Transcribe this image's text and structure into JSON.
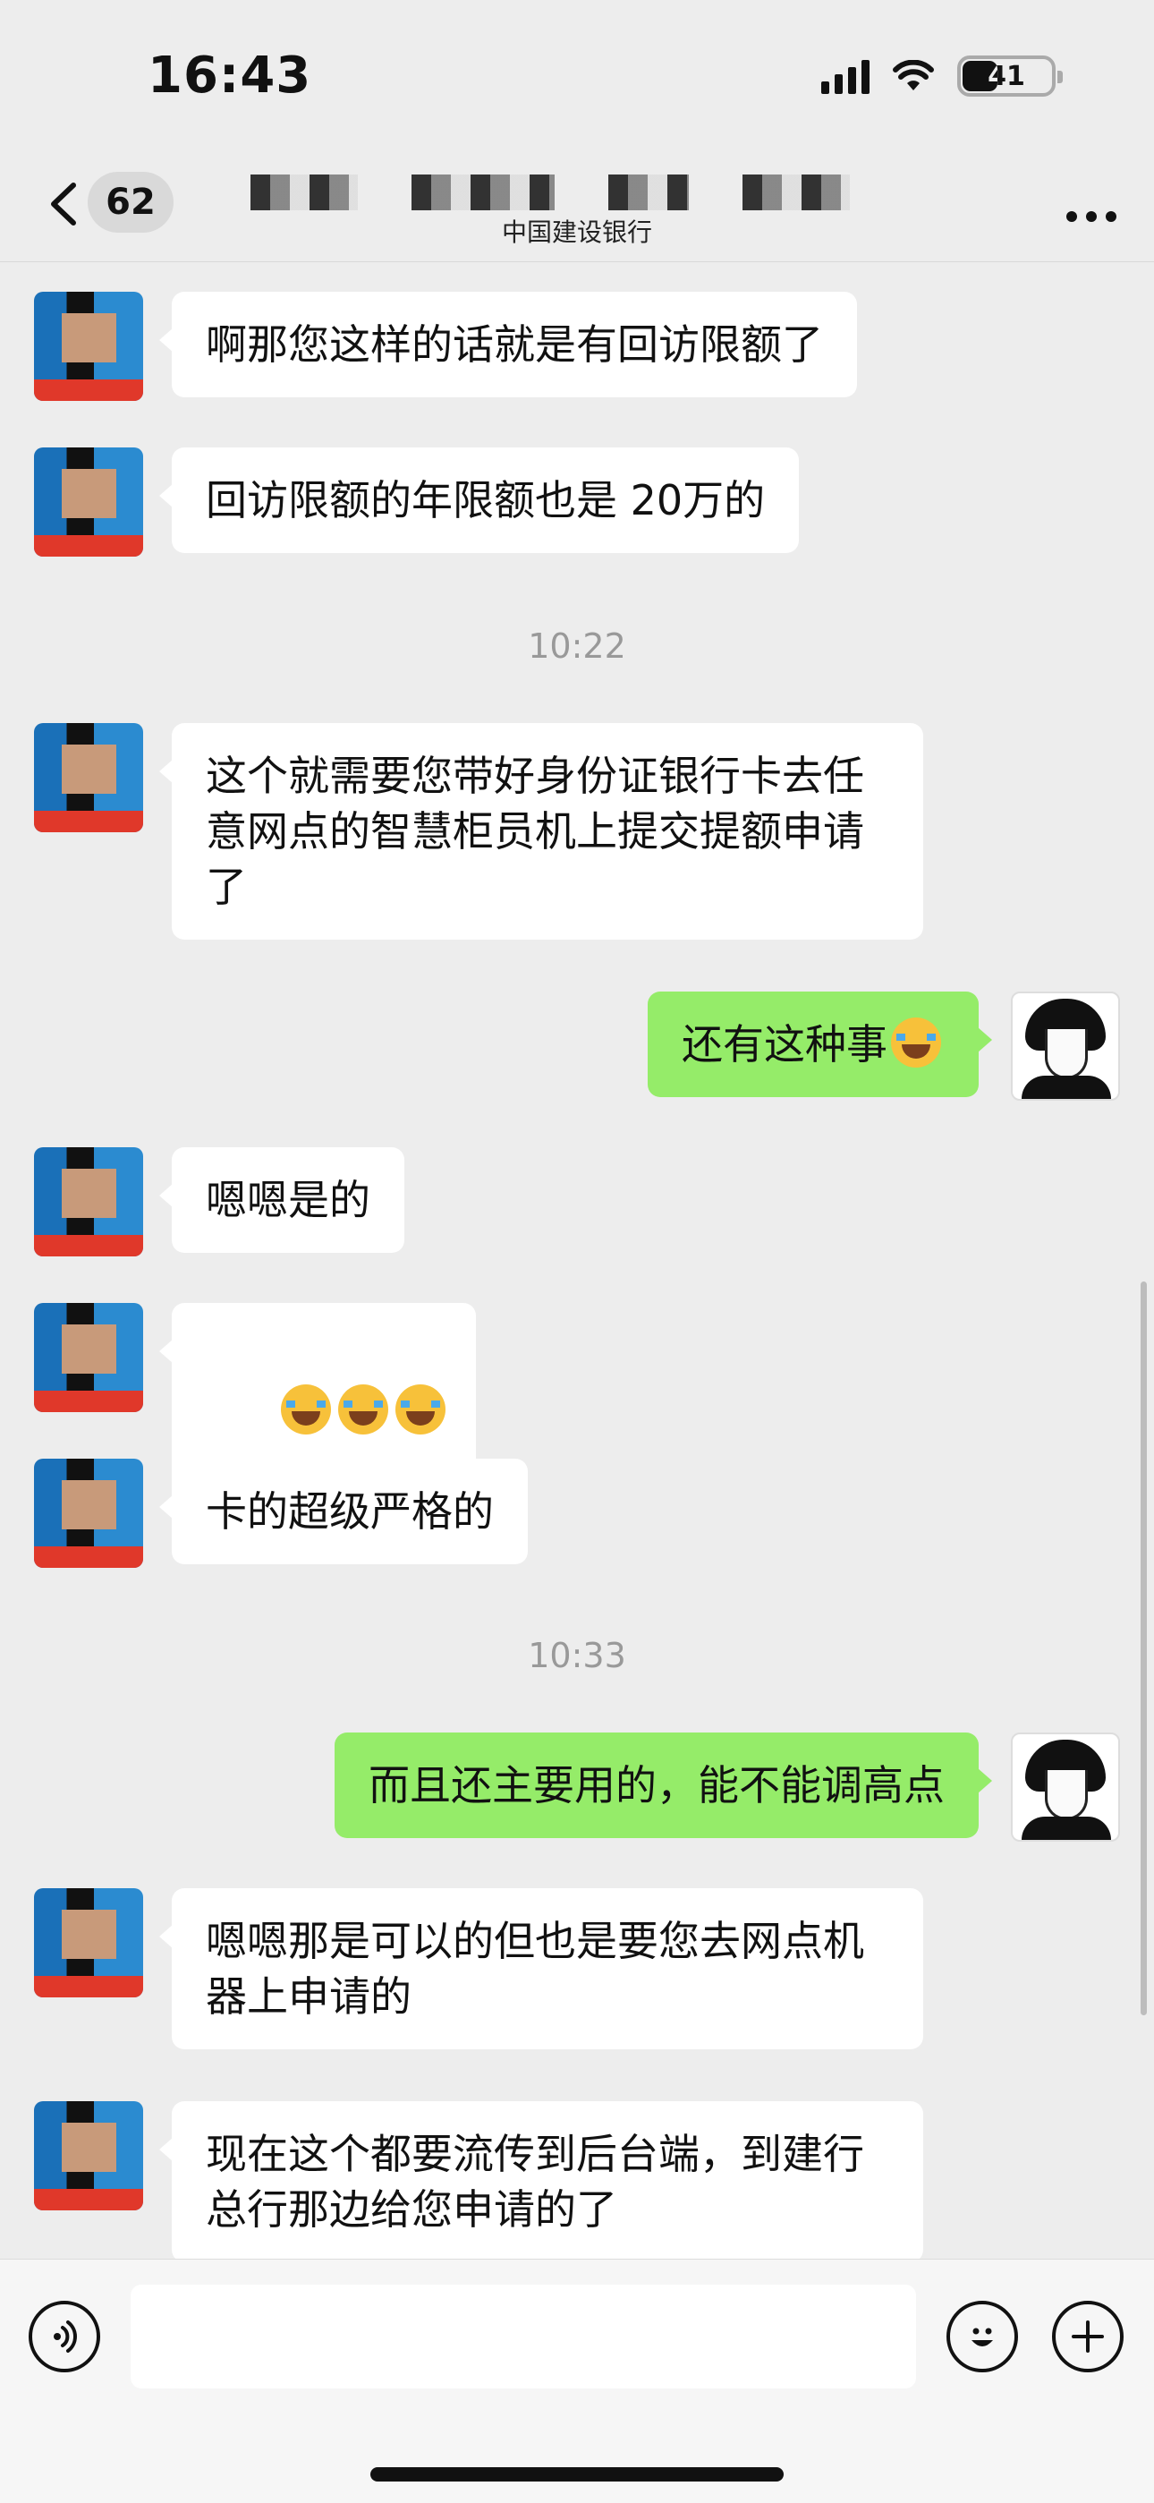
{
  "status_bar": {
    "time": "16:43",
    "battery": "41"
  },
  "nav": {
    "back_icon": "chevron-left-icon",
    "unread_count": "62",
    "subtitle": "中国建设银行",
    "more_icon": "more-dots-icon"
  },
  "messages": [
    {
      "side": "left",
      "text": "啊那您这样的话就是有回访限额了"
    },
    {
      "side": "left",
      "text": "回访限额的年限额也是 20万的"
    },
    {
      "side": "time",
      "text": "10:22"
    },
    {
      "side": "left",
      "text": "这个就需要您带好身份证银行卡去任意网点的智慧柜员机上提交提额申请了"
    },
    {
      "side": "right",
      "text": "还有这种事",
      "emoji": "face-with-tears-of-joy"
    },
    {
      "side": "left",
      "text": "嗯嗯是的"
    },
    {
      "side": "left",
      "text": "",
      "emoji_count": 3,
      "emoji": "face-with-tears-of-joy"
    },
    {
      "side": "left",
      "text": "卡的超级严格的"
    },
    {
      "side": "time",
      "text": "10:33"
    },
    {
      "side": "right",
      "text": "而且还主要用的，能不能调高点"
    },
    {
      "side": "left",
      "text": "嗯嗯那是可以的但也是要您去网点机器上申请的"
    },
    {
      "side": "left",
      "text": "现在这个都要流传到后台端，到建行总行那边给您申请的了"
    }
  ],
  "input_bar": {
    "voice_icon": "voice-icon",
    "emoji_icon": "smiley-icon",
    "plus_icon": "plus-icon",
    "text_value": ""
  }
}
